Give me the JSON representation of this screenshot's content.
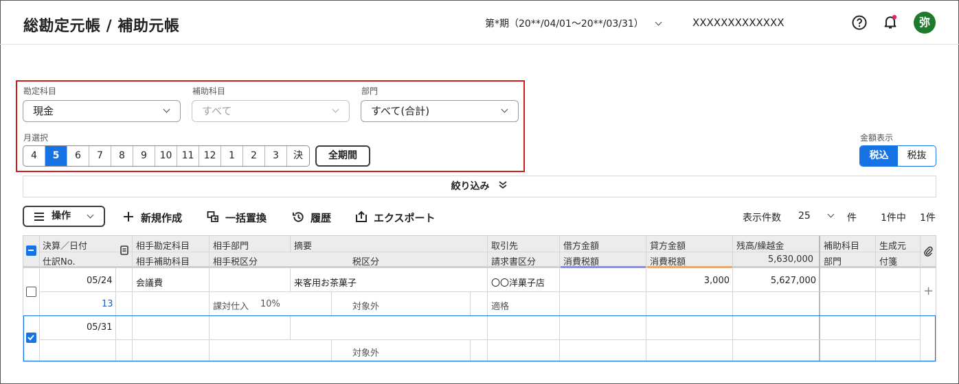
{
  "header": {
    "title": "総勘定元帳 / 補助元帳",
    "period": "第*期（20**/04/01〜20**/03/31）",
    "company": "XXXXXXXXXXXXX",
    "avatar": "弥"
  },
  "filters": {
    "account_label": "勘定科目",
    "account_value": "現金",
    "sub_label": "補助科目",
    "sub_value": "すべて",
    "dept_label": "部門",
    "dept_value": "すべて(合計)",
    "month_label": "月選択",
    "months": [
      "4",
      "5",
      "6",
      "7",
      "8",
      "9",
      "10",
      "11",
      "12",
      "1",
      "2",
      "3",
      "決"
    ],
    "selected_month": "5",
    "all_period": "全期間"
  },
  "amount_display": {
    "label": "金額表示",
    "incl": "税込",
    "excl": "税抜"
  },
  "filter_bar": "絞り込み",
  "toolbar": {
    "ops": "操作",
    "new": "新規作成",
    "bulk": "一括置換",
    "history": "履歴",
    "export": "エクスポート",
    "count_label": "表示件数",
    "count_value": "25",
    "count_unit": "件",
    "summary": "1件中",
    "summary_count": "1件"
  },
  "table": {
    "headers": {
      "date": "決算／日付",
      "no": "仕訳No.",
      "account": "相手勘定科目",
      "subaccount": "相手補助科目",
      "dept": "相手部門",
      "taxclass": "相手税区分",
      "memo": "摘要",
      "taxkbn": "税区分",
      "partner": "取引先",
      "invoice": "請求書区分",
      "debit": "借方金額",
      "debit_tax": "消費税額",
      "credit": "貸方金額",
      "credit_tax": "消費税額",
      "balance": "残高/繰越金",
      "balance_value": "5,630,000",
      "sub": "補助科目",
      "dept2": "部門",
      "origin": "生成元",
      "tag": "付箋"
    },
    "rows": [
      {
        "date": "05/24",
        "no": "13",
        "account": "会議費",
        "memo": "来客用お茶菓子",
        "partner": "〇〇洋菓子店",
        "credit": "3,000",
        "balance": "5,627,000",
        "taxclass": "課対仕入",
        "rate": "10%",
        "taxkbn": "対象外",
        "invoice": "適格",
        "checked": false
      },
      {
        "date": "05/31",
        "taxkbn": "対象外",
        "checked": true
      }
    ]
  }
}
